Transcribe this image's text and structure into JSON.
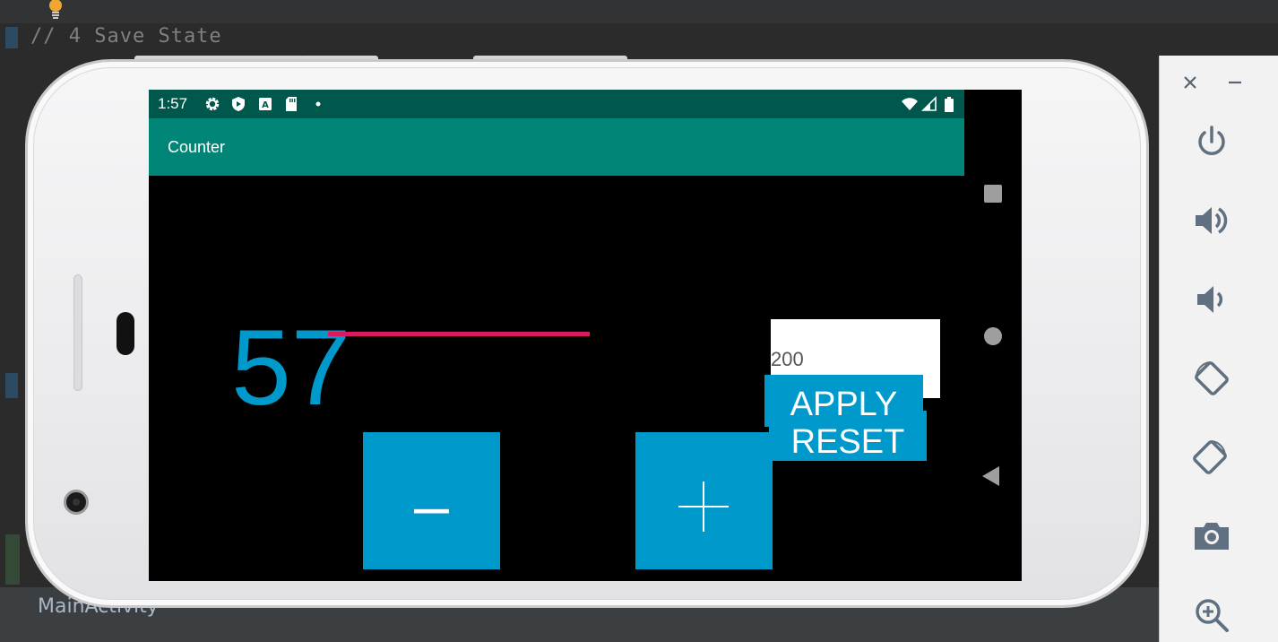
{
  "ide": {
    "comment_line": "// 4 Save State",
    "bottom_tab_label": "MainActivity"
  },
  "status_bar": {
    "time": "1:57",
    "icons": [
      "gear-icon",
      "shield-play-icon",
      "text-box-icon",
      "sd-card-icon",
      "dot-icon",
      "wifi-icon",
      "cell-signal-icon",
      "battery-icon"
    ]
  },
  "app": {
    "title": "Counter",
    "counter_value": "57",
    "amount_field_value": "200",
    "apply_label": "APPLY",
    "reset_label": "RESET",
    "minus_label": "–",
    "plus_label": "+"
  },
  "nav_bar": {
    "icons": [
      "recents-square-icon",
      "home-circle-icon",
      "back-triangle-icon"
    ]
  },
  "emulator_panel": {
    "icons": [
      "close-icon",
      "minimize-icon",
      "power-icon",
      "volume-up-icon",
      "volume-down-icon",
      "rotate-left-icon",
      "rotate-right-icon",
      "screenshot-camera-icon",
      "zoom-in-icon"
    ]
  },
  "colors": {
    "accent": "#0099cc",
    "status_bar": "#00574b",
    "app_bar": "#008577",
    "edit_underline": "#d81b60"
  }
}
